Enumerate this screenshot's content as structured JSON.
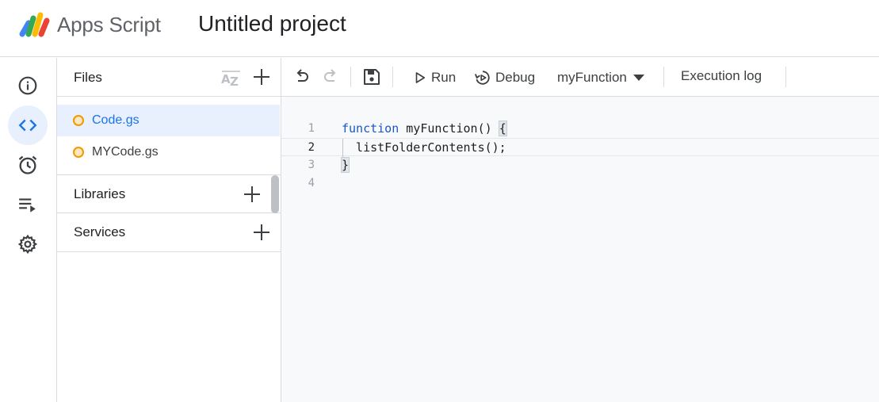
{
  "app": {
    "brand": "Apps Script",
    "project_title": "Untitled project"
  },
  "rail": {
    "items": [
      {
        "name": "overview",
        "icon": "info-icon"
      },
      {
        "name": "editor",
        "icon": "code-icon",
        "active": true
      },
      {
        "name": "triggers",
        "icon": "alarm-icon"
      },
      {
        "name": "executions",
        "icon": "executions-icon"
      },
      {
        "name": "settings",
        "icon": "gear-icon"
      }
    ]
  },
  "files": {
    "title": "Files",
    "items": [
      {
        "name": "Code.gs",
        "active": true
      },
      {
        "name": "MYCode.gs",
        "active": false
      }
    ]
  },
  "libraries": {
    "title": "Libraries"
  },
  "services": {
    "title": "Services"
  },
  "toolbar": {
    "run_label": "Run",
    "debug_label": "Debug",
    "function_selected": "myFunction",
    "execution_log_label": "Execution log"
  },
  "editor": {
    "lines": [
      {
        "num": "1",
        "kw": "function",
        "rest": " myFunction() ",
        "brace": "{"
      },
      {
        "num": "2",
        "text": "  listFolderContents();"
      },
      {
        "num": "3",
        "brace": "}"
      },
      {
        "num": "4",
        "text": ""
      }
    ]
  },
  "colors": {
    "accent": "#1a73e8",
    "active_bg": "#e8f0fe",
    "file_dot": "#f29900",
    "keyword": "#1a56c9"
  }
}
